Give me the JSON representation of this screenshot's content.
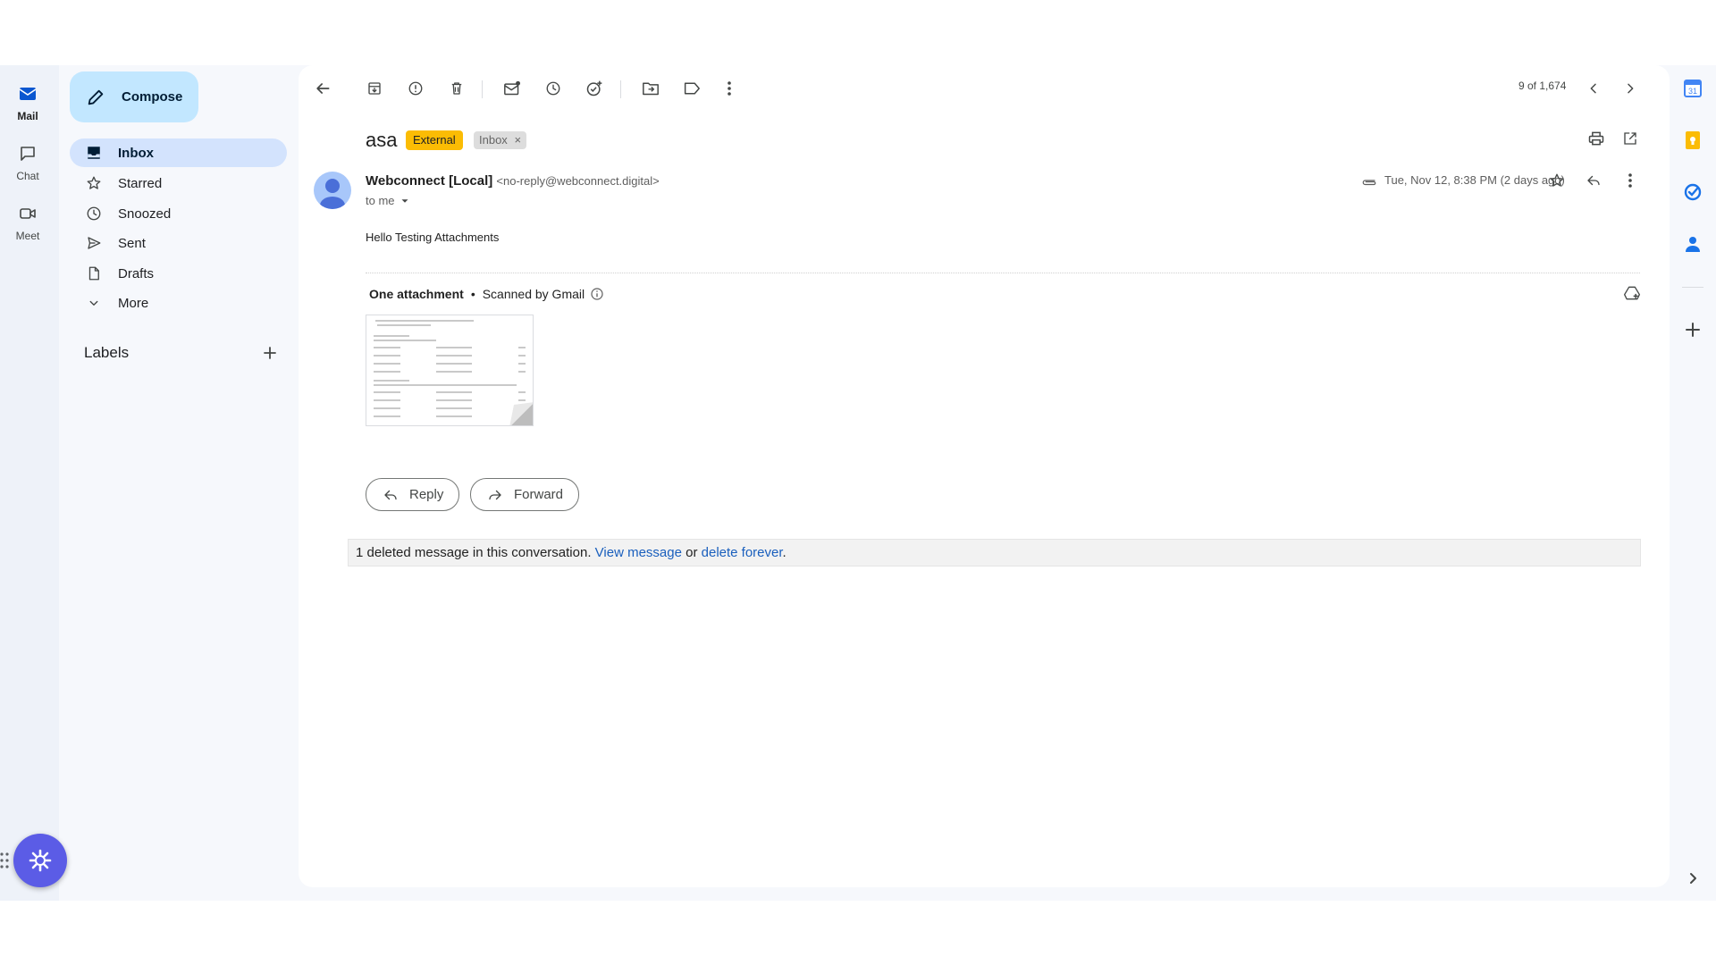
{
  "rail": {
    "items": [
      {
        "label": "Mail",
        "icon": "mail-icon"
      },
      {
        "label": "Chat",
        "icon": "chat-icon"
      },
      {
        "label": "Meet",
        "icon": "video-icon"
      }
    ]
  },
  "sidebar": {
    "compose_label": "Compose",
    "items": [
      {
        "label": "Inbox",
        "icon": "inbox-icon"
      },
      {
        "label": "Starred",
        "icon": "star-icon"
      },
      {
        "label": "Snoozed",
        "icon": "clock-icon"
      },
      {
        "label": "Sent",
        "icon": "send-icon"
      },
      {
        "label": "Drafts",
        "icon": "draft-icon"
      },
      {
        "label": "More",
        "icon": "chevron-down-icon"
      }
    ],
    "labels_heading": "Labels"
  },
  "toolbar": {
    "pager": "9 of 1,674"
  },
  "email": {
    "subject": "asa",
    "chip_external": "External",
    "chip_inbox": "Inbox",
    "chip_close": "×",
    "sender_name": "Webconnect [Local]",
    "sender_email": "<no-reply@webconnect.digital>",
    "to": "to me",
    "date": "Tue, Nov 12, 8:38 PM (2 days ago)",
    "body": "Hello Testing Attachments"
  },
  "attachments": {
    "title": "One attachment",
    "separator": "•",
    "scanned": "Scanned by Gmail"
  },
  "actions": {
    "reply": "Reply",
    "forward": "Forward"
  },
  "deleted": {
    "text": "1 deleted message in this conversation.",
    "view": "View message",
    "or": "or",
    "forever": "delete forever",
    "period": "."
  },
  "colors": {
    "accent": "#0b57d0",
    "compose_bg": "#c2e7ff",
    "active_nav": "#d3e3fd",
    "external_chip": "#fbbc04",
    "fab": "#5b5ce6"
  }
}
